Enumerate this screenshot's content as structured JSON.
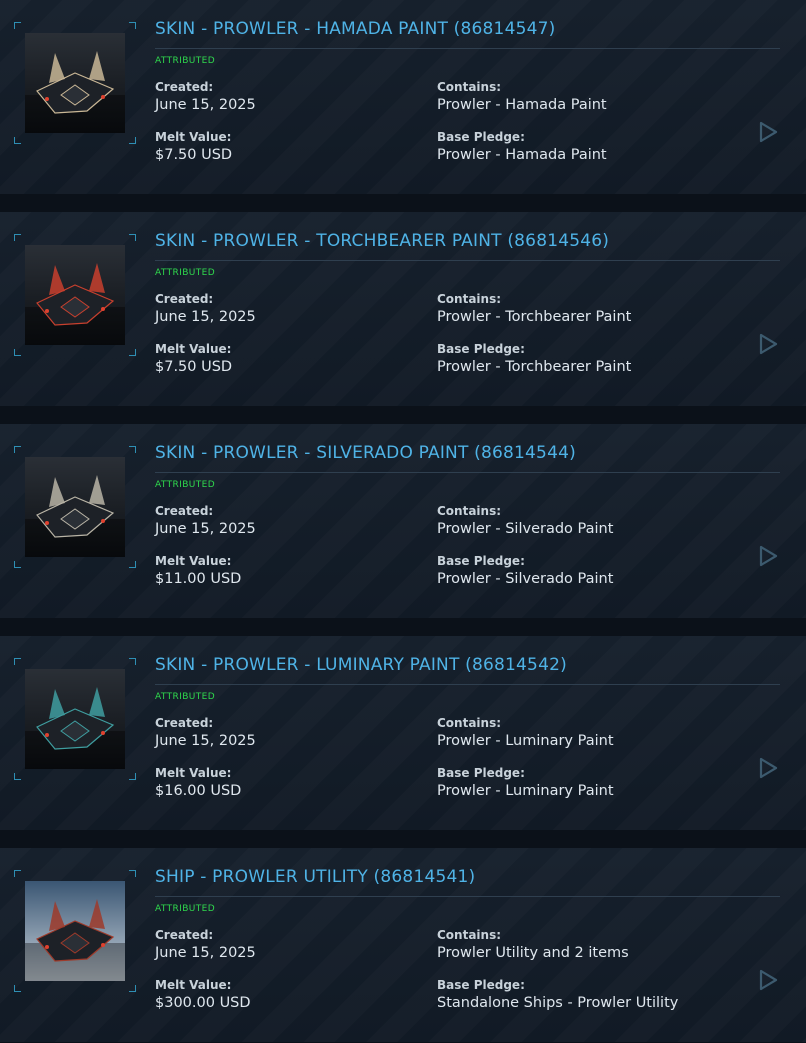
{
  "labels": {
    "created": "Created:",
    "contains": "Contains:",
    "melt_value": "Melt Value:",
    "base_pledge": "Base Pledge:"
  },
  "colors": {
    "title": "#4fb3e6",
    "attributed": "#2fd84d",
    "corner_accent": "#2e8fb4",
    "background": "#0b1119",
    "card": "#131c27"
  },
  "items": [
    {
      "title": "SKIN - PROWLER - HAMADA PAINT (86814547)",
      "badge": "ATTRIBUTED",
      "created": "June 15, 2025",
      "contains": "Prowler - Hamada Paint",
      "melt_value": "$7.50 USD",
      "base_pledge": "Prowler - Hamada Paint",
      "thumb_accent": "#c9b796",
      "thumb_icon": "prowler-hamada-thumbnail"
    },
    {
      "title": "SKIN - PROWLER - TORCHBEARER PAINT (86814546)",
      "badge": "ATTRIBUTED",
      "created": "June 15, 2025",
      "contains": "Prowler - Torchbearer Paint",
      "melt_value": "$7.50 USD",
      "base_pledge": "Prowler - Torchbearer Paint",
      "thumb_accent": "#c8402e",
      "thumb_icon": "prowler-torchbearer-thumbnail"
    },
    {
      "title": "SKIN - PROWLER - SILVERADO PAINT (86814544)",
      "badge": "ATTRIBUTED",
      "created": "June 15, 2025",
      "contains": "Prowler - Silverado Paint",
      "melt_value": "$11.00 USD",
      "base_pledge": "Prowler - Silverado Paint",
      "thumb_accent": "#b9b4a6",
      "thumb_icon": "prowler-silverado-thumbnail"
    },
    {
      "title": "SKIN - PROWLER - LUMINARY PAINT (86814542)",
      "badge": "ATTRIBUTED",
      "created": "June 15, 2025",
      "contains": "Prowler - Luminary Paint",
      "melt_value": "$16.00 USD",
      "base_pledge": "Prowler - Luminary Paint",
      "thumb_accent": "#3f9ea0",
      "thumb_icon": "prowler-luminary-thumbnail"
    },
    {
      "title": "SHIP - PROWLER UTILITY (86814541)",
      "badge": "ATTRIBUTED",
      "created": "June 15, 2025",
      "contains": "Prowler Utility and 2 items",
      "melt_value": "$300.00 USD",
      "base_pledge": "Standalone Ships - Prowler Utility",
      "thumb_accent": "#9e3a2a",
      "thumb_icon": "prowler-utility-thumbnail"
    }
  ],
  "action_icon": "play-arrow-icon"
}
